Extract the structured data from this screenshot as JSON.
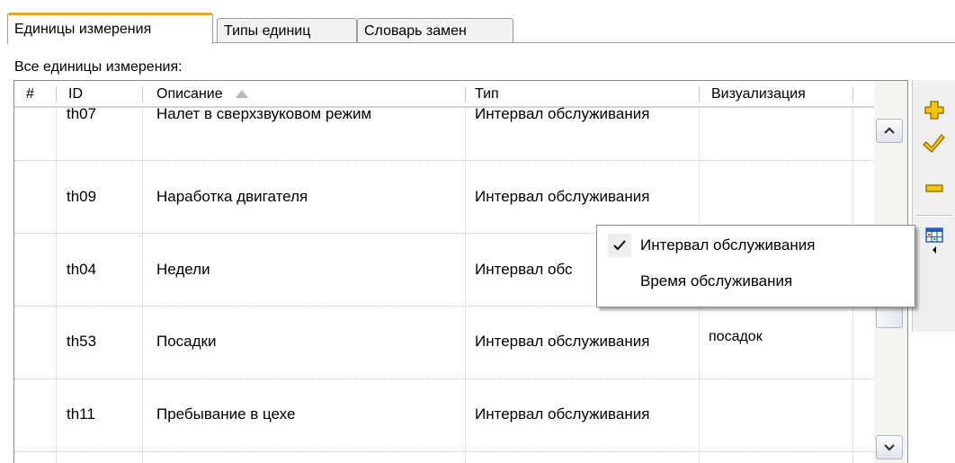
{
  "tabs": [
    {
      "label": "Единицы измерения",
      "active": true
    },
    {
      "label": "Типы единиц",
      "active": false
    },
    {
      "label": "Словарь замен",
      "active": false
    }
  ],
  "caption": "Все единицы измерения:",
  "columns": {
    "num": "#",
    "id": "ID",
    "desc": "Описание",
    "type": "Тип",
    "vis": "Визуализация"
  },
  "sort": {
    "column": "Описание",
    "direction": "ascending"
  },
  "rows": [
    {
      "id": "th07",
      "desc": "Налет в сверхзвуковом режим",
      "type": "Интервал обслуживания",
      "vis": ""
    },
    {
      "id": "th09",
      "desc": "Наработка двигателя",
      "type": "Интервал обслуживания",
      "vis": ""
    },
    {
      "id": "th04",
      "desc": "Недели",
      "type": "Интервал обс",
      "vis": ""
    },
    {
      "id": "th53",
      "desc": "Посадки",
      "type": "Интервал обслуживания",
      "vis": "посадок"
    },
    {
      "id": "th11",
      "desc": "Пребывание в цехе",
      "type": "Интервал обслуживания",
      "vis": ""
    }
  ],
  "menu": {
    "items": [
      {
        "label": "Интервал обслуживания",
        "checked": true
      },
      {
        "label": "Время обслуживания",
        "checked": false
      }
    ]
  },
  "toolbar": {
    "icons": [
      "add-icon",
      "apply-check-icon",
      "remove-icon",
      "column-chooser-icon"
    ]
  },
  "colors": {
    "tab_accent": "#f0a030",
    "icon_yellow": "#f5c400"
  }
}
